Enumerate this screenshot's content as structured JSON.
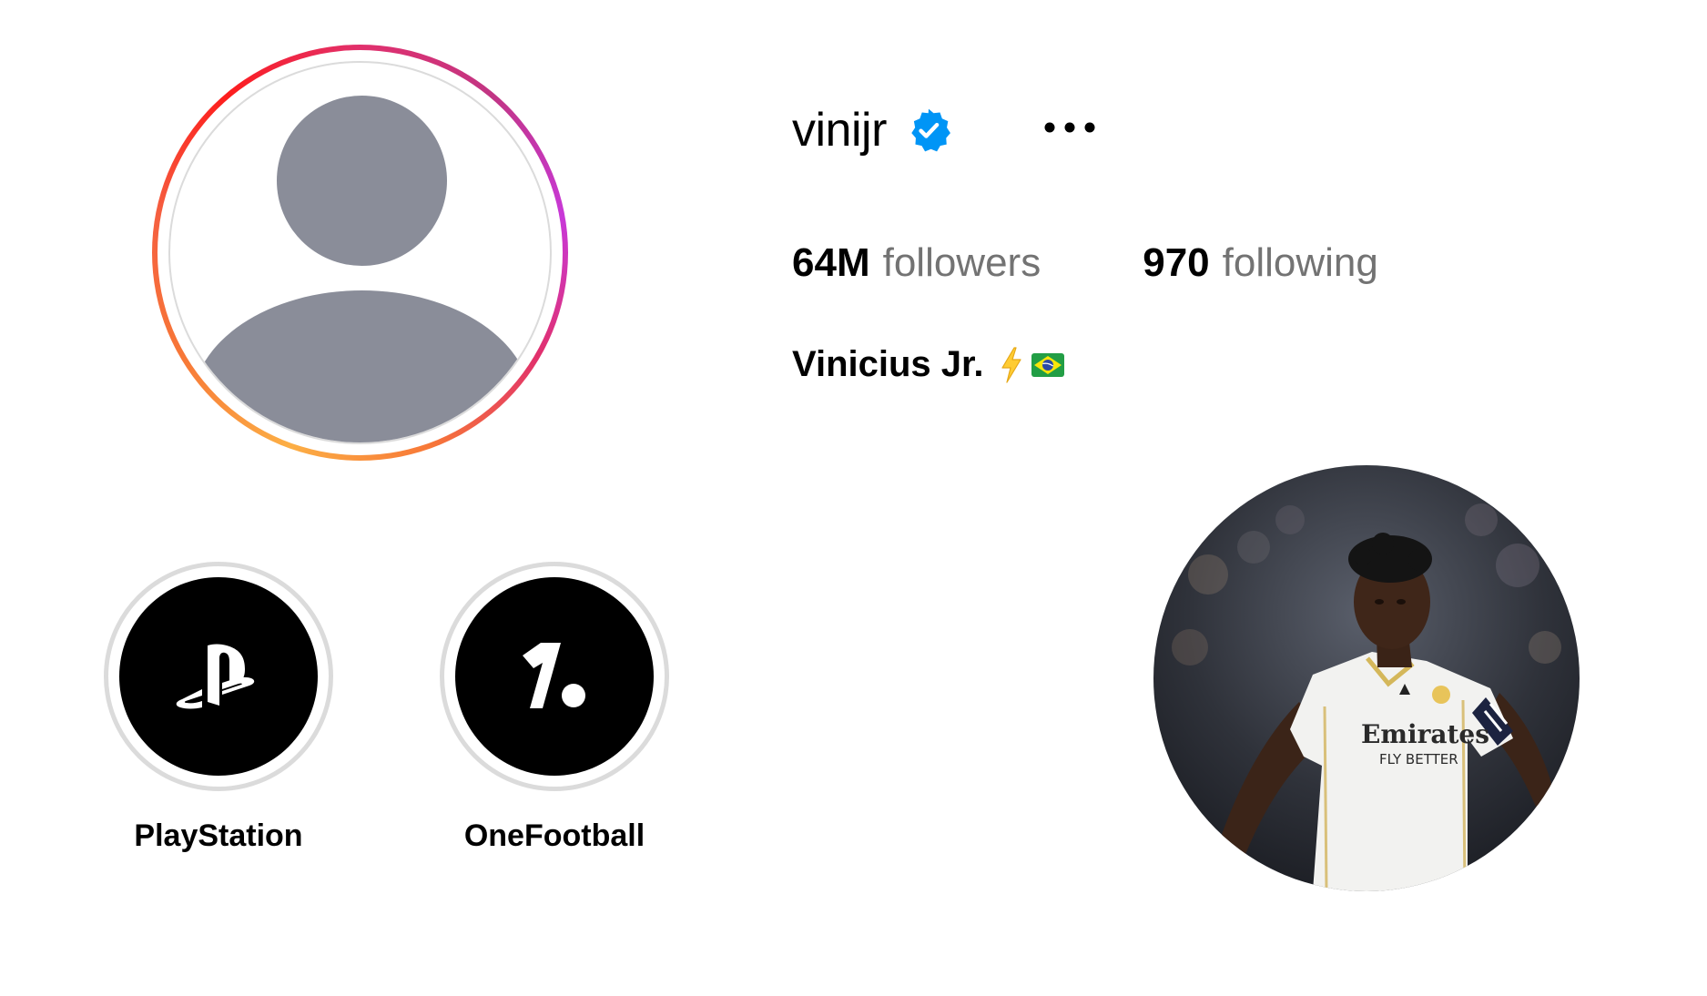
{
  "profile": {
    "username": "vinijr",
    "verified": true,
    "full_name": "Vinicius Jr.",
    "bio_emojis": [
      "lightning-icon",
      "brazil-flag-icon"
    ],
    "avatar": "default-avatar-icon",
    "story_ring": true
  },
  "stats": {
    "followers_value": "64M",
    "followers_label": "followers",
    "following_value": "970",
    "following_label": "following"
  },
  "highlights": [
    {
      "label": "PlayStation",
      "icon": "playstation-logo-icon"
    },
    {
      "label": "OneFootball",
      "icon": "onefootball-logo-icon"
    }
  ],
  "photo": {
    "subject": "player-photo",
    "kit_text_line1": "Emirates",
    "kit_text_line2": "FLY BETTER"
  },
  "colors": {
    "verified_blue": "#0095f6",
    "muted_text": "#737373",
    "ring_border": "#dbdbdb",
    "placeholder_gray": "#8a8d99"
  }
}
